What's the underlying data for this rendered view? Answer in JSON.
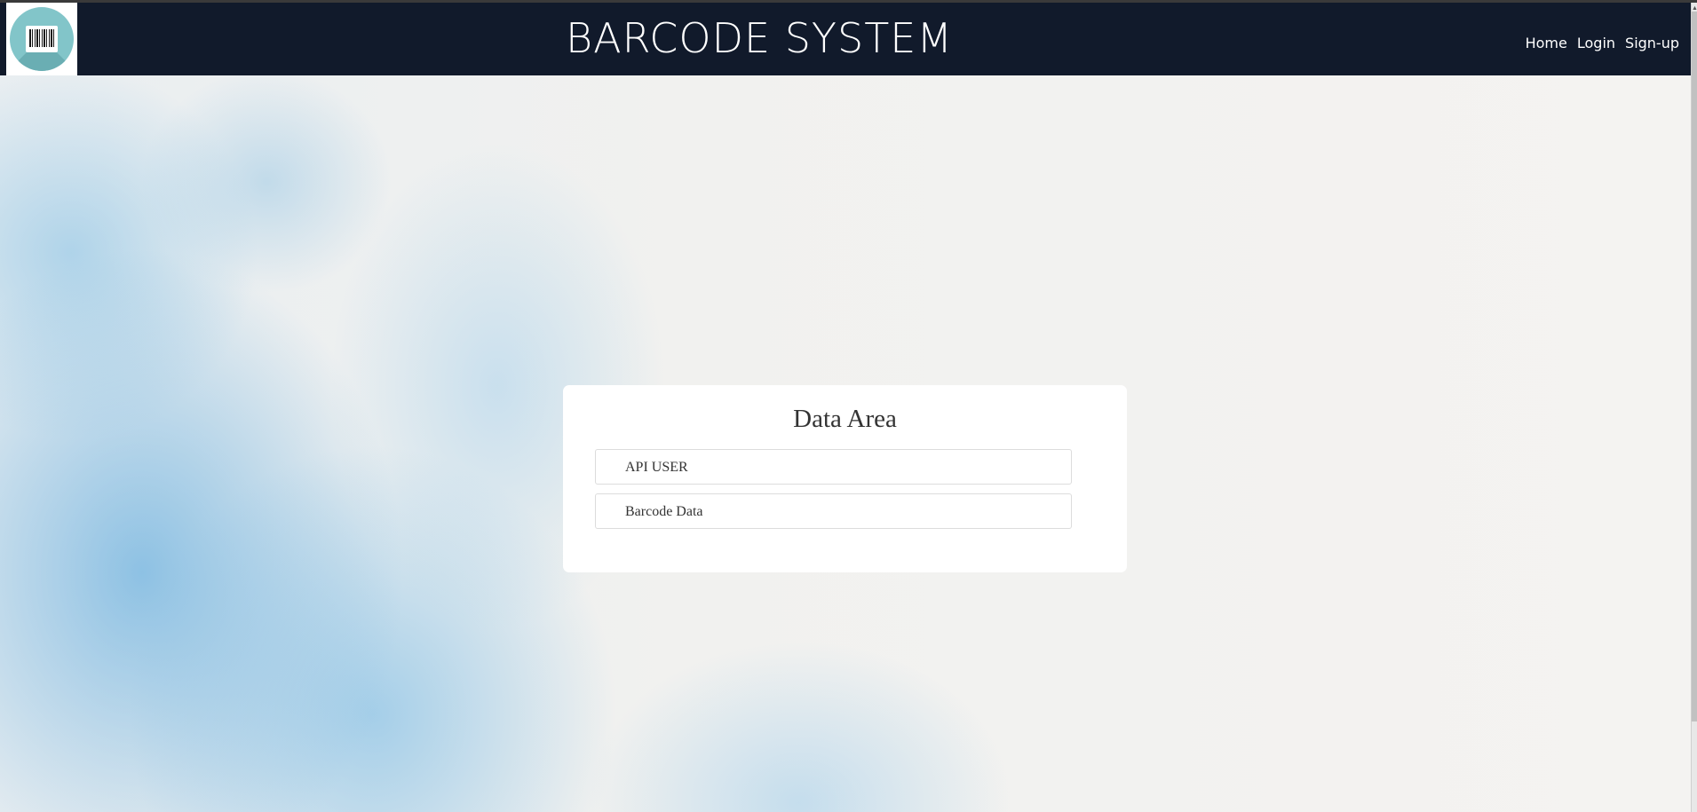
{
  "header": {
    "title": "BARCODE SYSTEM",
    "logo_icon": "barcode-icon",
    "nav": [
      {
        "label": "Home"
      },
      {
        "label": "Login"
      },
      {
        "label": "Sign-up"
      }
    ]
  },
  "card": {
    "title": "Data Area",
    "items": [
      {
        "label": "API USER"
      },
      {
        "label": "Barcode Data"
      }
    ]
  },
  "colors": {
    "navbar": "#111a2b",
    "logo_circle": "#82c5c9",
    "card": "#ffffff"
  }
}
